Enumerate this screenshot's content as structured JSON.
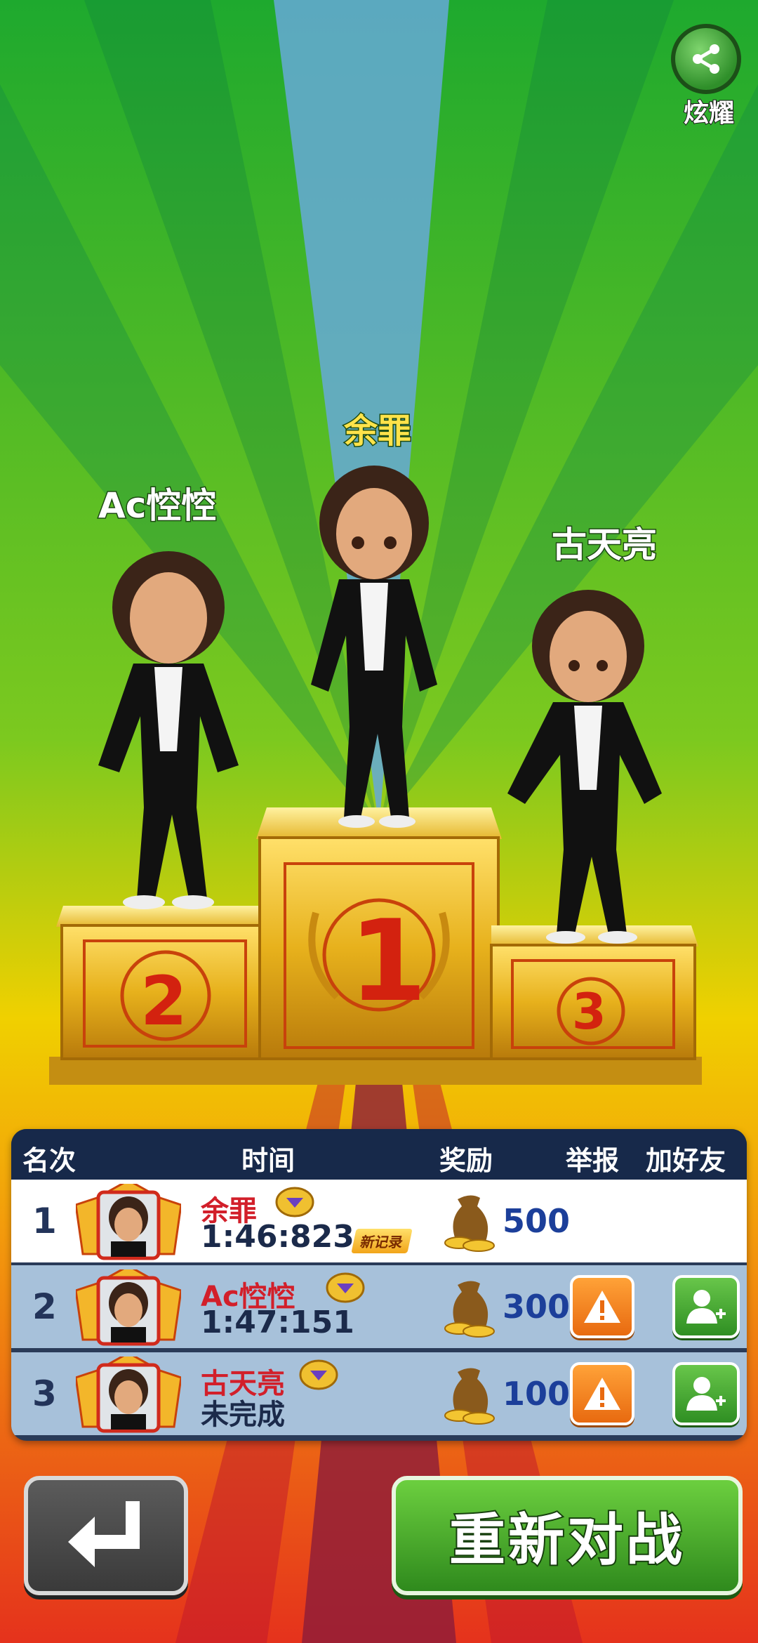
{
  "share": {
    "label": "炫耀"
  },
  "podium": {
    "first": {
      "name": "余罪",
      "place": "1"
    },
    "second": {
      "name": "Ac悾悾",
      "place": "2"
    },
    "third": {
      "name": "古天亮",
      "place": "3"
    }
  },
  "table": {
    "headers": {
      "rank": "名次",
      "time": "时间",
      "reward": "奖励",
      "report": "举报",
      "add_friend": "加好友"
    },
    "rows": [
      {
        "rank": "1",
        "name": "余罪",
        "time": "1:46:823",
        "badge": "新记录",
        "reward": "500"
      },
      {
        "rank": "2",
        "name": "Ac悾悾",
        "time": "1:47:151",
        "reward": "300"
      },
      {
        "rank": "3",
        "name": "古天亮",
        "time": "未完成",
        "reward": "100"
      }
    ]
  },
  "buttons": {
    "back_icon": "return-arrow-icon",
    "rematch": "重新对战"
  },
  "colors": {
    "name_red": "#d21f2a",
    "gold": "#e8b422",
    "rematch_green": "#3fa82a",
    "report_orange": "#f07d1a"
  }
}
